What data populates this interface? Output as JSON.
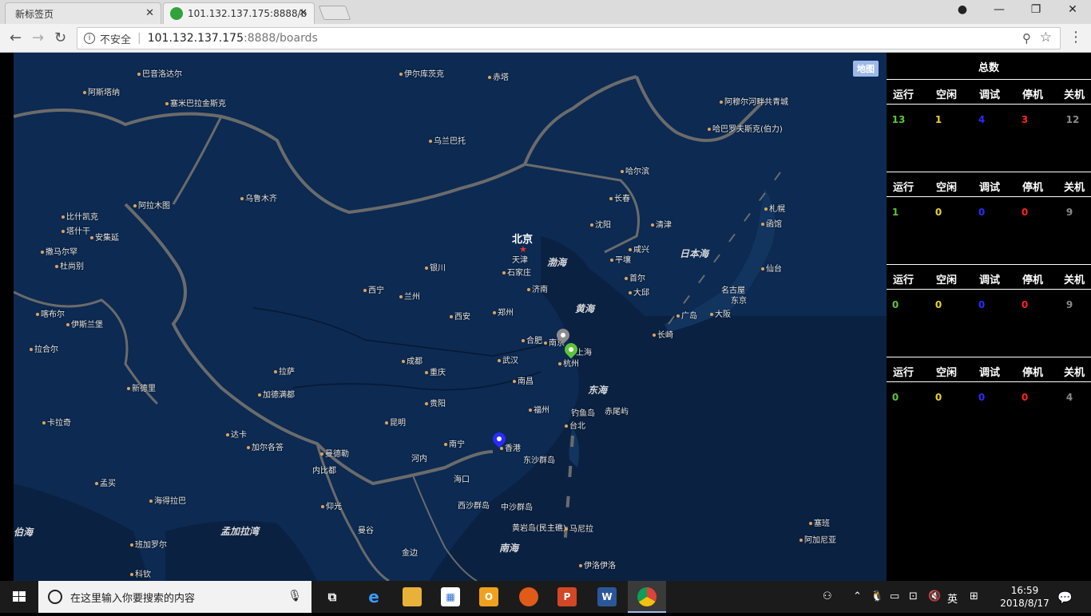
{
  "browser": {
    "tabs": [
      {
        "title": "新标签页"
      },
      {
        "title": "101.132.137.175:8888/b"
      }
    ],
    "address": {
      "insecure_label": "不安全",
      "host": "101.132.137.175",
      "path": ":8888/boards"
    }
  },
  "map": {
    "toggle_label": "地图",
    "capital": "北京",
    "seas": [
      "渤海",
      "黄海",
      "东海",
      "日本海",
      "南海",
      "孟加拉湾",
      "伯海"
    ],
    "cities": [
      "巴音洛达尔",
      "阿斯塔纳",
      "塞米巴拉金斯克",
      "乌兰巴托",
      "伊尔库茨克",
      "赤塔",
      "阿穆尔河畔共青城",
      "哈巴罗夫斯克(伯力)",
      "哈尔滨",
      "长春",
      "沈阳",
      "清津",
      "札幌",
      "函馆",
      "乌鲁木齐",
      "阿拉木图",
      "比什凯克",
      "塔什干",
      "安集延",
      "撒马尔罕",
      "杜尚别",
      "喀布尔",
      "伊斯兰堡",
      "拉合尔",
      "新德里",
      "加德满都",
      "拉萨",
      "西宁",
      "银川",
      "兰州",
      "西安",
      "成都",
      "重庆",
      "贵阳",
      "昆明",
      "南宁",
      "香港",
      "海口",
      "河内",
      "曼德勒",
      "内比都",
      "仰光",
      "曼谷",
      "金边",
      "天津",
      "石家庄",
      "济南",
      "郑州",
      "合肥",
      "南京",
      "上海",
      "杭州",
      "武汉",
      "南昌",
      "福州",
      "台北",
      "钓鱼岛",
      "赤尾屿",
      "平壤",
      "首尔",
      "大邱",
      "咸兴",
      "东京",
      "名古屋",
      "大阪",
      "广岛",
      "长崎",
      "仙台",
      "东沙群岛",
      "西沙群岛",
      "中沙群岛",
      "黄岩岛(民主礁)",
      "马尼拉",
      "伊洛伊洛",
      "塞班",
      "阿加尼亚",
      "达卡",
      "加尔各答",
      "孟买",
      "卡拉奇",
      "科钦",
      "班加罗尔",
      "海得拉巴"
    ]
  },
  "panel": {
    "title": "总数",
    "headers": [
      "运行",
      "空闲",
      "调试",
      "停机",
      "关机"
    ],
    "colors": [
      "#5dc43a",
      "#e8d22a",
      "#2b2bff",
      "#ff2222",
      "#8a8a8a"
    ],
    "groups": [
      {
        "values": [
          "13",
          "1",
          "4",
          "3",
          "12"
        ]
      },
      {
        "values": [
          "1",
          "0",
          "0",
          "0",
          "9"
        ]
      },
      {
        "values": [
          "0",
          "0",
          "0",
          "0",
          "9"
        ]
      },
      {
        "values": [
          "0",
          "0",
          "0",
          "0",
          "4"
        ]
      }
    ]
  },
  "taskbar": {
    "search_placeholder": "在这里输入你要搜索的内容",
    "ime": "英",
    "time": "16:59",
    "date": "2018/8/17"
  }
}
